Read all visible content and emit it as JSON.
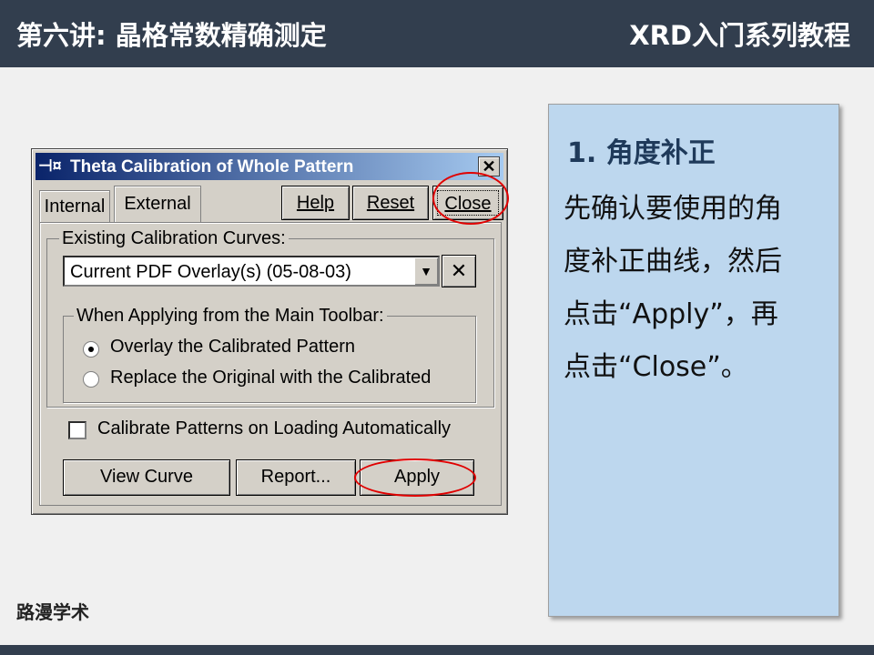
{
  "header": {
    "left_title": "第六讲: 晶格常数精确测定",
    "right_title": "XRD入门系列教程"
  },
  "footer": {
    "brand": "路漫学术"
  },
  "dialog": {
    "title": "Theta Calibration of Whole Pattern",
    "close_x": "✕",
    "tabs": [
      {
        "label": "Internal"
      },
      {
        "label": "External"
      }
    ],
    "buttons": {
      "help": "Help",
      "reset": "Reset",
      "close": "Close",
      "view_curve": "View Curve",
      "report": "Report...",
      "apply": "Apply"
    },
    "existing_group": {
      "legend": "Existing Calibration Curves:",
      "combo_value": "Current PDF Overlay(s) (05-08-03)",
      "clear_button": "✕"
    },
    "when_group": {
      "legend": "When Applying from the Main Toolbar:",
      "options": [
        {
          "label": "Overlay the Calibrated Pattern",
          "selected": true
        },
        {
          "label": "Replace the Original with the Calibrated",
          "selected": false
        }
      ]
    },
    "checkbox": {
      "label": "Calibrate Patterns on Loading Automatically",
      "checked": false
    }
  },
  "note": {
    "heading": "1. 角度补正",
    "lines": [
      "先确认要使用的角",
      "度补正曲线，然后",
      "点击“Apply”，再",
      "点击“Close”。"
    ]
  },
  "colors": {
    "header_bg": "#323e4e",
    "note_bg": "#bdd7ee",
    "highlight_ring": "#e00000"
  }
}
